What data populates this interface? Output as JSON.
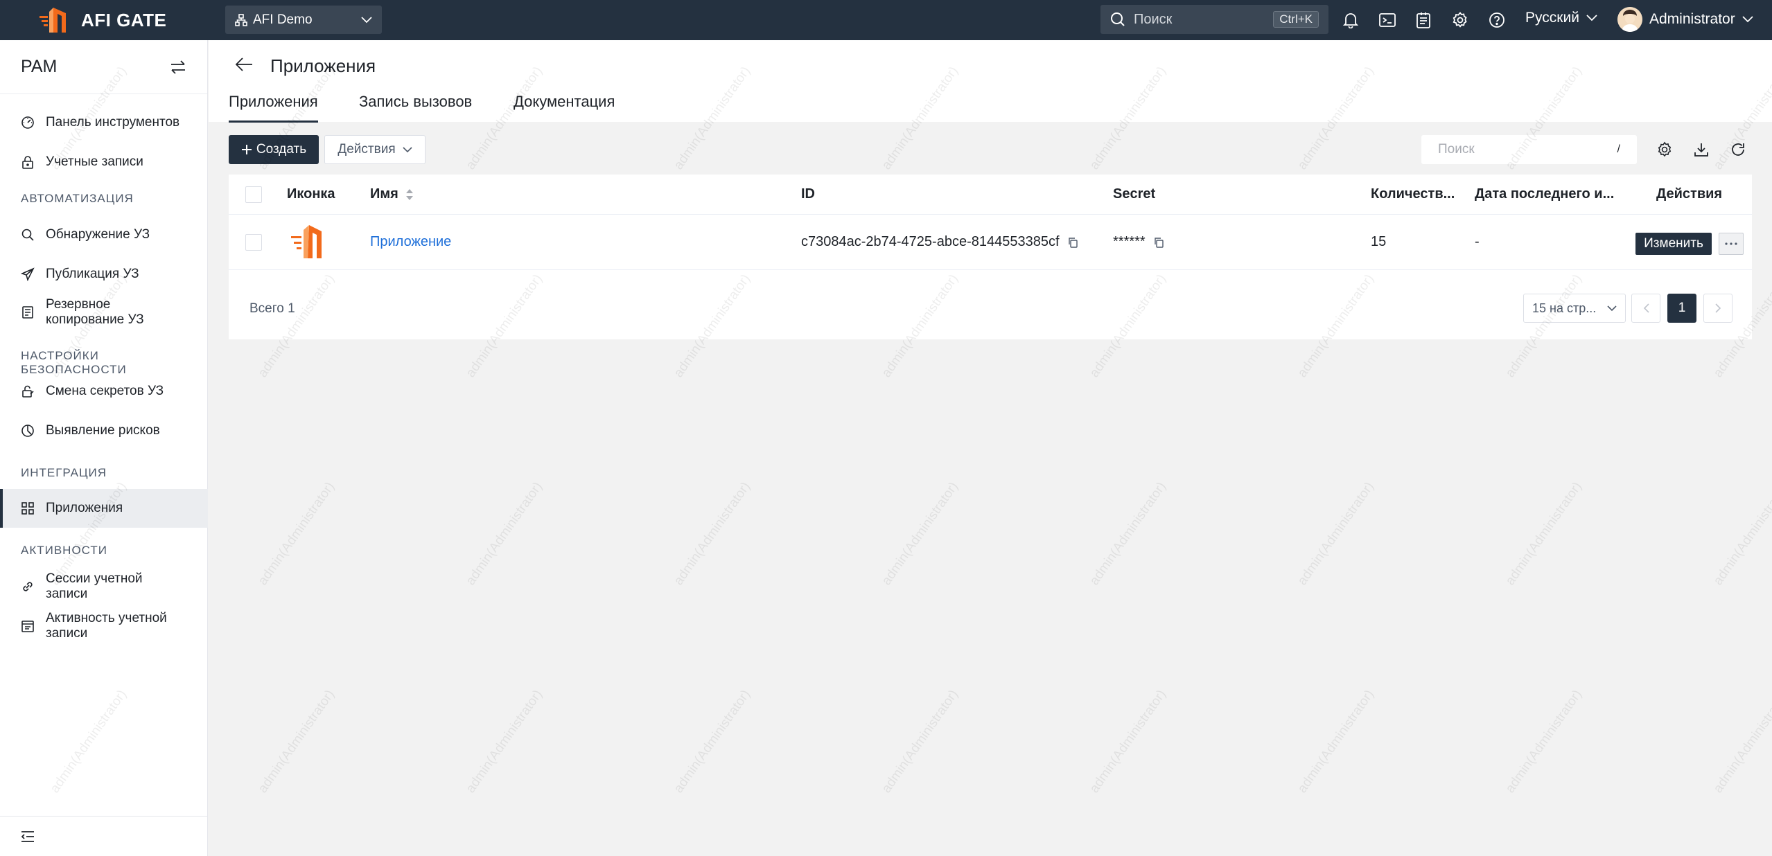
{
  "topbar": {
    "brand": "AFI GATE",
    "org": "AFI Demo",
    "search_placeholder": "Поиск",
    "search_shortcut": "Ctrl+K",
    "language": "Русский",
    "user": "Administrator"
  },
  "sidebar": {
    "title": "PAM",
    "items": [
      {
        "label": "Панель инструментов",
        "icon": "dashboard-icon"
      },
      {
        "label": "Учетные записи",
        "icon": "lock-icon"
      }
    ],
    "groups": {
      "automation": "АВТОМАТИЗАЦИЯ",
      "security": "НАСТРОЙКИ БЕЗОПАСНОСТИ",
      "integration": "ИНТЕГРАЦИЯ",
      "activity": "АКТИВНОСТИ"
    },
    "automation_items": [
      {
        "label": "Обнаружение УЗ",
        "icon": "search-icon"
      },
      {
        "label": "Публикация УЗ",
        "icon": "send-icon"
      },
      {
        "label": "Резервное копирование УЗ",
        "icon": "backup-icon"
      }
    ],
    "security_items": [
      {
        "label": "Смена секретов УЗ",
        "icon": "secret-rotate-icon"
      },
      {
        "label": "Выявление рисков",
        "icon": "risk-icon"
      }
    ],
    "integration_items": [
      {
        "label": "Приложения",
        "icon": "apps-icon"
      }
    ],
    "activity_items": [
      {
        "label": "Сессии учетной записи",
        "icon": "link-icon"
      },
      {
        "label": "Активность учетной записи",
        "icon": "activity-log-icon"
      }
    ]
  },
  "page": {
    "title": "Приложения",
    "tabs": [
      "Приложения",
      "Запись вызовов",
      "Документация"
    ],
    "active_tab": 0
  },
  "toolbar": {
    "create_label": "Создать",
    "actions_label": "Действия",
    "search_placeholder": "Поиск",
    "search_shortcut": "/"
  },
  "table": {
    "columns": [
      "Иконка",
      "Имя",
      "ID",
      "Secret",
      "Количеств...",
      "Дата последнего и...",
      "Действия"
    ],
    "rows": [
      {
        "name": "Приложение",
        "id": "c73084ac-2b74-4725-abce-8144553385cf",
        "secret": "******",
        "count": "15",
        "last_date": "-",
        "edit_label": "Изменить"
      }
    ],
    "total": "Всего 1",
    "per_page": "15 на стр...",
    "current_page": "1"
  },
  "watermark": "admin(Administrator)",
  "colors": {
    "topbar": "#243140",
    "brand_orange": "#f26a1b",
    "link": "#1e6fd9"
  }
}
